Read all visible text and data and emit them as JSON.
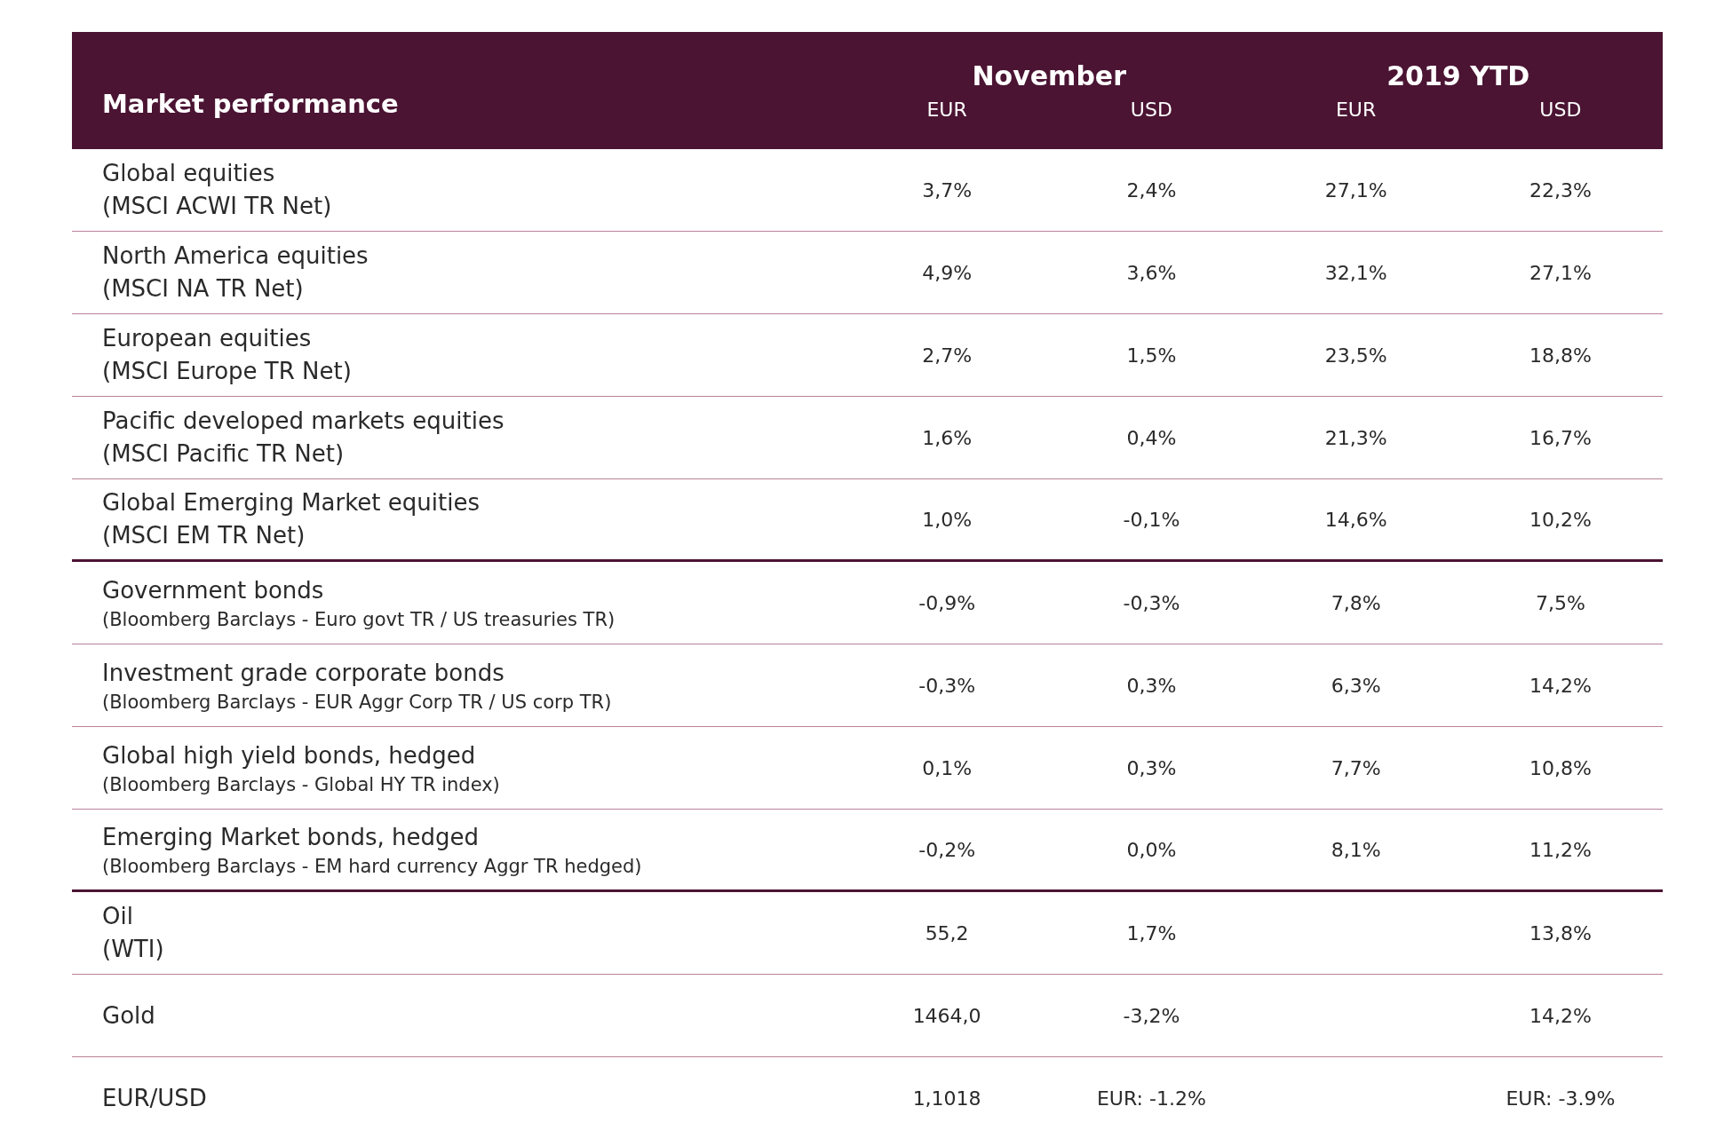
{
  "table": {
    "title": "Market performance",
    "column_groups": [
      {
        "label": "November",
        "columns": [
          "EUR",
          "USD"
        ]
      },
      {
        "label": "2019 YTD",
        "columns": [
          "EUR",
          "USD"
        ]
      }
    ],
    "groups": [
      {
        "rows": [
          {
            "kind": "equity",
            "label": "Global equities",
            "sublabel": "(MSCI ACWI TR Net)",
            "november_eur": "3,7%",
            "november_usd": "2,4%",
            "ytd_eur": "27,1%",
            "ytd_usd": "22,3%"
          },
          {
            "kind": "equity",
            "label": "North America equities",
            "sublabel": "(MSCI NA TR Net)",
            "november_eur": "4,9%",
            "november_usd": "3,6%",
            "ytd_eur": "32,1%",
            "ytd_usd": "27,1%"
          },
          {
            "kind": "equity",
            "label": "European equities",
            "sublabel": "(MSCI Europe TR Net)",
            "november_eur": "2,7%",
            "november_usd": "1,5%",
            "ytd_eur": "23,5%",
            "ytd_usd": "18,8%"
          },
          {
            "kind": "equity",
            "label": "Pacific developed markets equities",
            "sublabel": "(MSCI Pacific TR Net)",
            "november_eur": "1,6%",
            "november_usd": "0,4%",
            "ytd_eur": "21,3%",
            "ytd_usd": "16,7%"
          },
          {
            "kind": "equity",
            "label": "Global Emerging Market equities",
            "sublabel": "(MSCI EM TR Net)",
            "november_eur": "1,0%",
            "november_usd": "-0,1%",
            "ytd_eur": "14,6%",
            "ytd_usd": "10,2%"
          }
        ]
      },
      {
        "rows": [
          {
            "kind": "bond",
            "label": "Government bonds",
            "sublabel": "(Bloomberg Barclays - Euro govt TR / US treasuries TR)",
            "november_eur": "-0,9%",
            "november_usd": "-0,3%",
            "ytd_eur": "7,8%",
            "ytd_usd": "7,5%"
          },
          {
            "kind": "bond",
            "label": "Investment grade corporate bonds",
            "sublabel": "(Bloomberg Barclays - EUR Aggr Corp TR / US corp TR)",
            "november_eur": "-0,3%",
            "november_usd": "0,3%",
            "ytd_eur": "6,3%",
            "ytd_usd": "14,2%"
          },
          {
            "kind": "bond",
            "label": "Global high yield bonds, hedged",
            "sublabel": "(Bloomberg Barclays - Global HY TR index)",
            "november_eur": "0,1%",
            "november_usd": "0,3%",
            "ytd_eur": "7,7%",
            "ytd_usd": "10,8%"
          },
          {
            "kind": "bond",
            "label": "Emerging Market bonds, hedged",
            "sublabel": "(Bloomberg Barclays - EM hard currency Aggr TR hedged)",
            "november_eur": "-0,2%",
            "november_usd": "0,0%",
            "ytd_eur": "8,1%",
            "ytd_usd": "11,2%"
          }
        ]
      },
      {
        "rows": [
          {
            "kind": "equity",
            "label": "Oil",
            "sublabel": "(WTI)",
            "november_eur": "55,2",
            "november_usd": "1,7%",
            "ytd_usd": "13,8%"
          },
          {
            "kind": "equity",
            "label": "Gold",
            "november_eur": "1464,0",
            "november_usd": "-3,2%",
            "ytd_usd": "14,2%"
          },
          {
            "kind": "equity",
            "label": "EUR/USD",
            "november_eur": "1,1018",
            "november_usd": "EUR: -1.2%",
            "ytd_usd": "EUR: -3.9%"
          }
        ]
      }
    ]
  }
}
